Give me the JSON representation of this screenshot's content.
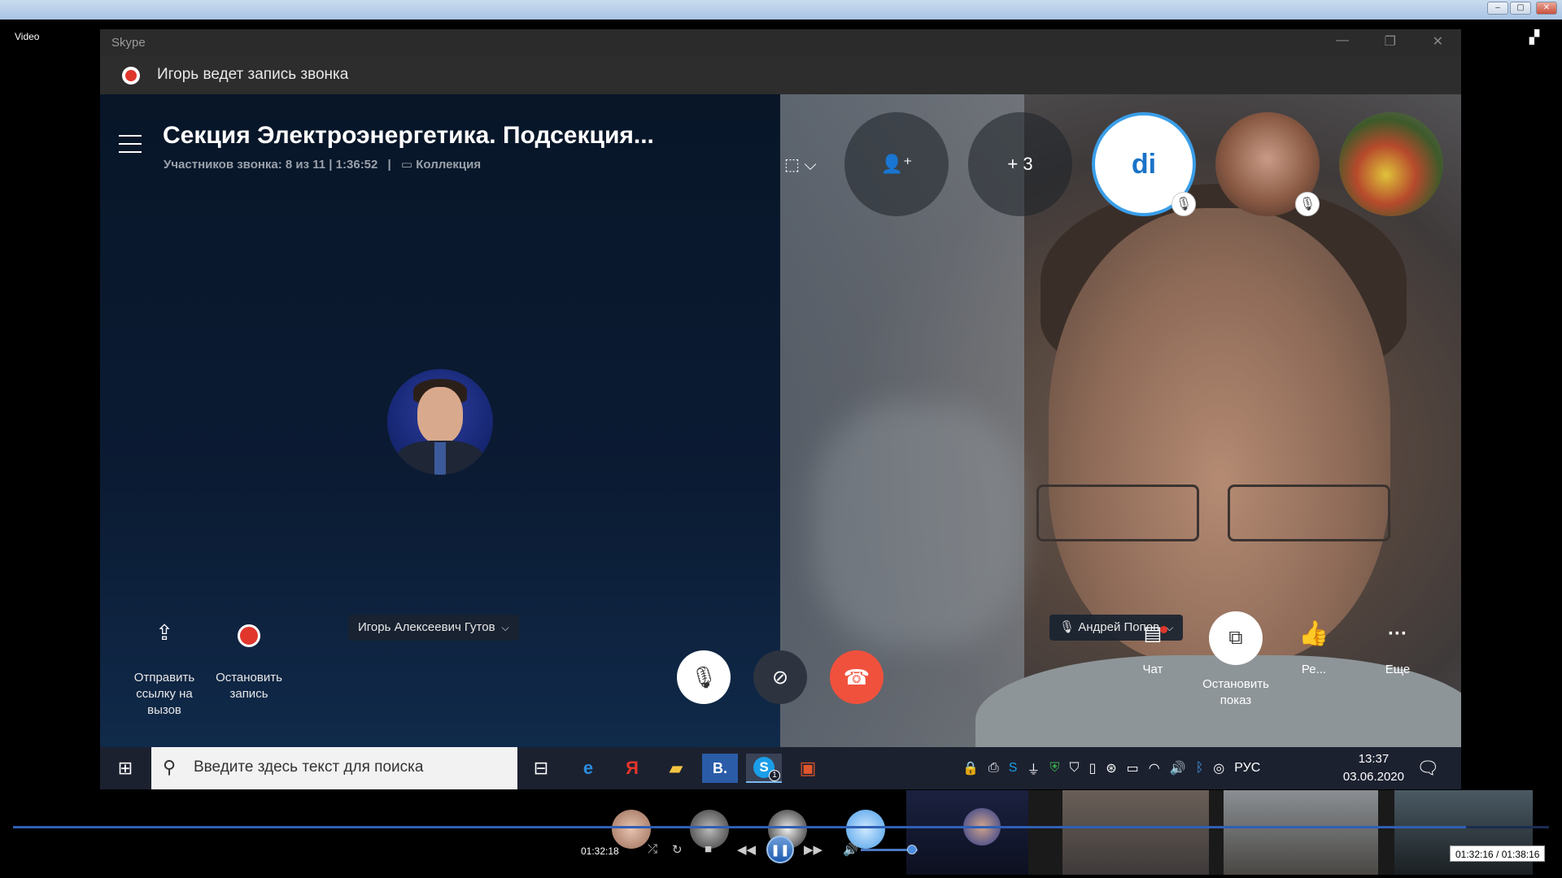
{
  "player": {
    "window_label": "Video",
    "time_elapsed": "01:32:18",
    "time_display": "01:32:16 / 01:38:16",
    "progress": 0.946,
    "volume": 0.9
  },
  "skype": {
    "app_title": "Skype",
    "recording_banner": "Игорь ведет запись звонка",
    "call_title": "Секция Электроэнергетика. Подсекция...",
    "call_subtitle": "Участников звонка: 8 из 11 | 1:36:52",
    "collection_label": "Коллекция",
    "presenter_name": "Игорь Алексеевич Гутов",
    "speaker_name": "Андрей Попов",
    "more_participants": "+ 3",
    "participant_initials": "di",
    "actions_left": [
      {
        "label": "Отправить ссылку на вызов",
        "icon": "share-icon"
      },
      {
        "label": "Остановить запись",
        "icon": "record-icon"
      }
    ],
    "actions_right": [
      {
        "label": "Чат",
        "icon": "chat-icon"
      },
      {
        "label": "Остановить показ",
        "icon": "stop-share-icon"
      },
      {
        "label": "Ре...",
        "icon": "thumbs-up-icon"
      },
      {
        "label": "Еще",
        "icon": "more-icon"
      }
    ]
  },
  "taskbar": {
    "search_placeholder": "Введите здесь текст для поиска",
    "language": "РУС",
    "time": "13:37",
    "date": "03.06.2020",
    "skype_badge": "1"
  },
  "colors": {
    "end_call": "#f0513c",
    "record_red": "#e0362c",
    "scrub_blue": "#2f5fb5"
  }
}
